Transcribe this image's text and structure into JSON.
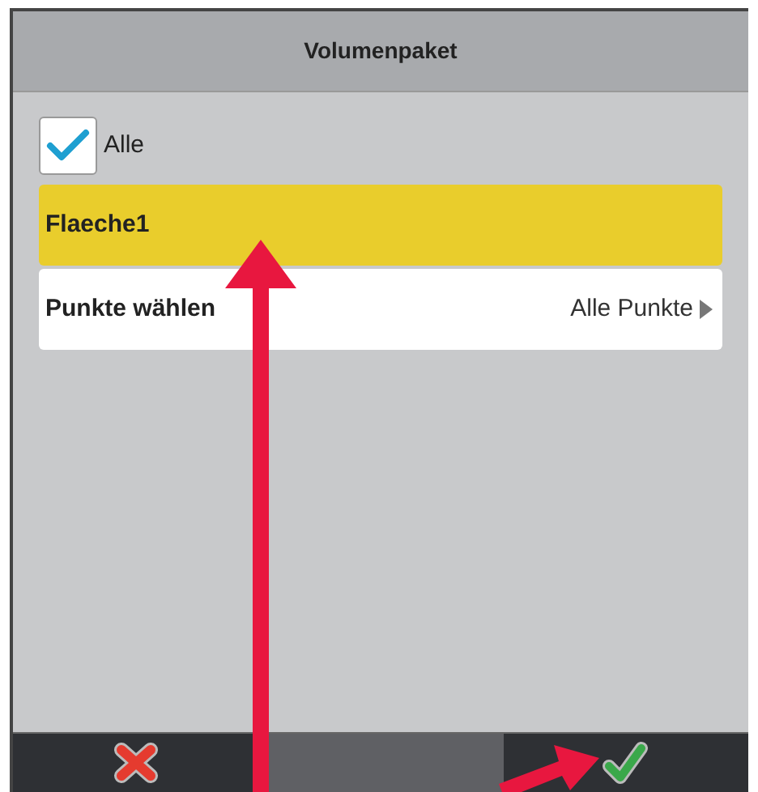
{
  "window": {
    "title": "Volumenpaket"
  },
  "select_all": {
    "label": "Alle",
    "checked": true
  },
  "items": [
    {
      "kind": "area",
      "label": "Flaeche1",
      "selected": true
    },
    {
      "kind": "picker",
      "label": "Punkte wählen",
      "value": "Alle Punkte",
      "selected": false
    }
  ],
  "footer": [
    {
      "kind": "cancel"
    },
    {
      "kind": "spacer"
    },
    {
      "kind": "confirm"
    }
  ]
}
